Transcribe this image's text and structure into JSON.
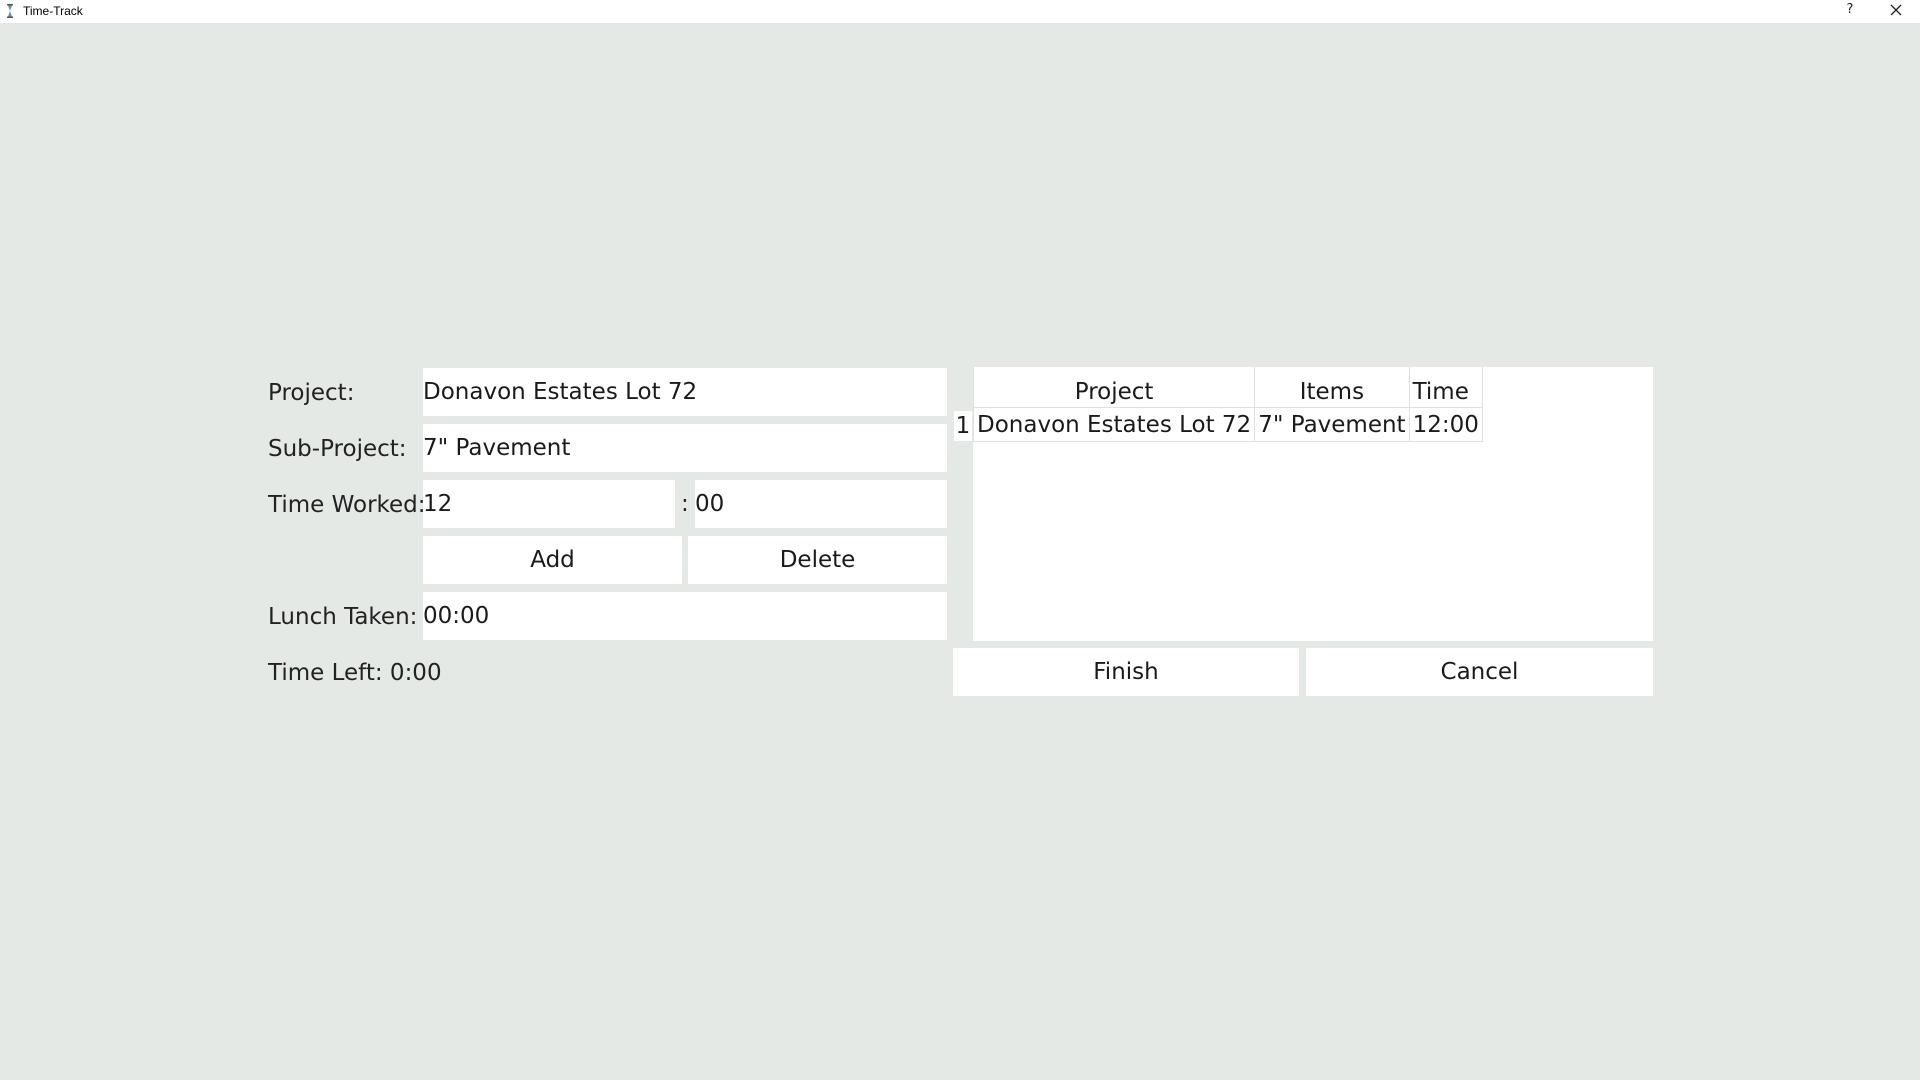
{
  "window": {
    "title": "Time-Track",
    "help_label": "?"
  },
  "form": {
    "project_label": "Project:",
    "project_value": "Donavon Estates Lot 72",
    "subproject_label": "Sub-Project:",
    "subproject_value": "7\" Pavement",
    "time_worked_label": "Time Worked:",
    "hours_value": "12",
    "separator": ":",
    "minutes_value": "00",
    "add_label": "Add",
    "delete_label": "Delete",
    "lunch_label": "Lunch Taken:",
    "lunch_value": "00:00",
    "time_left_label": "Time Left: 0:00"
  },
  "table": {
    "columns": [
      "Project",
      "Items",
      "Time"
    ],
    "rows": [
      {
        "num": "1",
        "project": "Donavon Estates Lot 72",
        "items": "7\" Pavement",
        "time": "12:00"
      }
    ]
  },
  "actions": {
    "finish_label": "Finish",
    "cancel_label": "Cancel"
  },
  "icons": {
    "app": "hourglass-icon",
    "close": "close-icon"
  }
}
